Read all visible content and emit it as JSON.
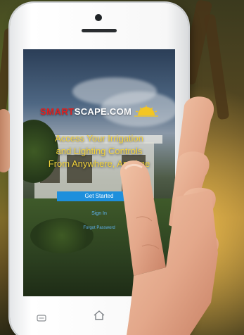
{
  "logo": {
    "smart": "SMART",
    "scape": "SCAPE.COM",
    "sun_icon": "sun-icon"
  },
  "headline": {
    "line1": "Access Your Irrigation",
    "line2": "and Lighting Controls",
    "line3": "From Anywhere, Anytime"
  },
  "actions": {
    "get_started": "Get Started",
    "sign_in": "Sign In",
    "forgot_password": "Forgot Password"
  },
  "phone_buttons": {
    "menu_icon": "menu-icon",
    "home_icon": "home-icon"
  },
  "colors": {
    "accent_blue": "#1e8fdc",
    "headline_yellow": "#f3d33b",
    "brand_red": "#e02020",
    "link_blue": "#5fb3f0"
  }
}
